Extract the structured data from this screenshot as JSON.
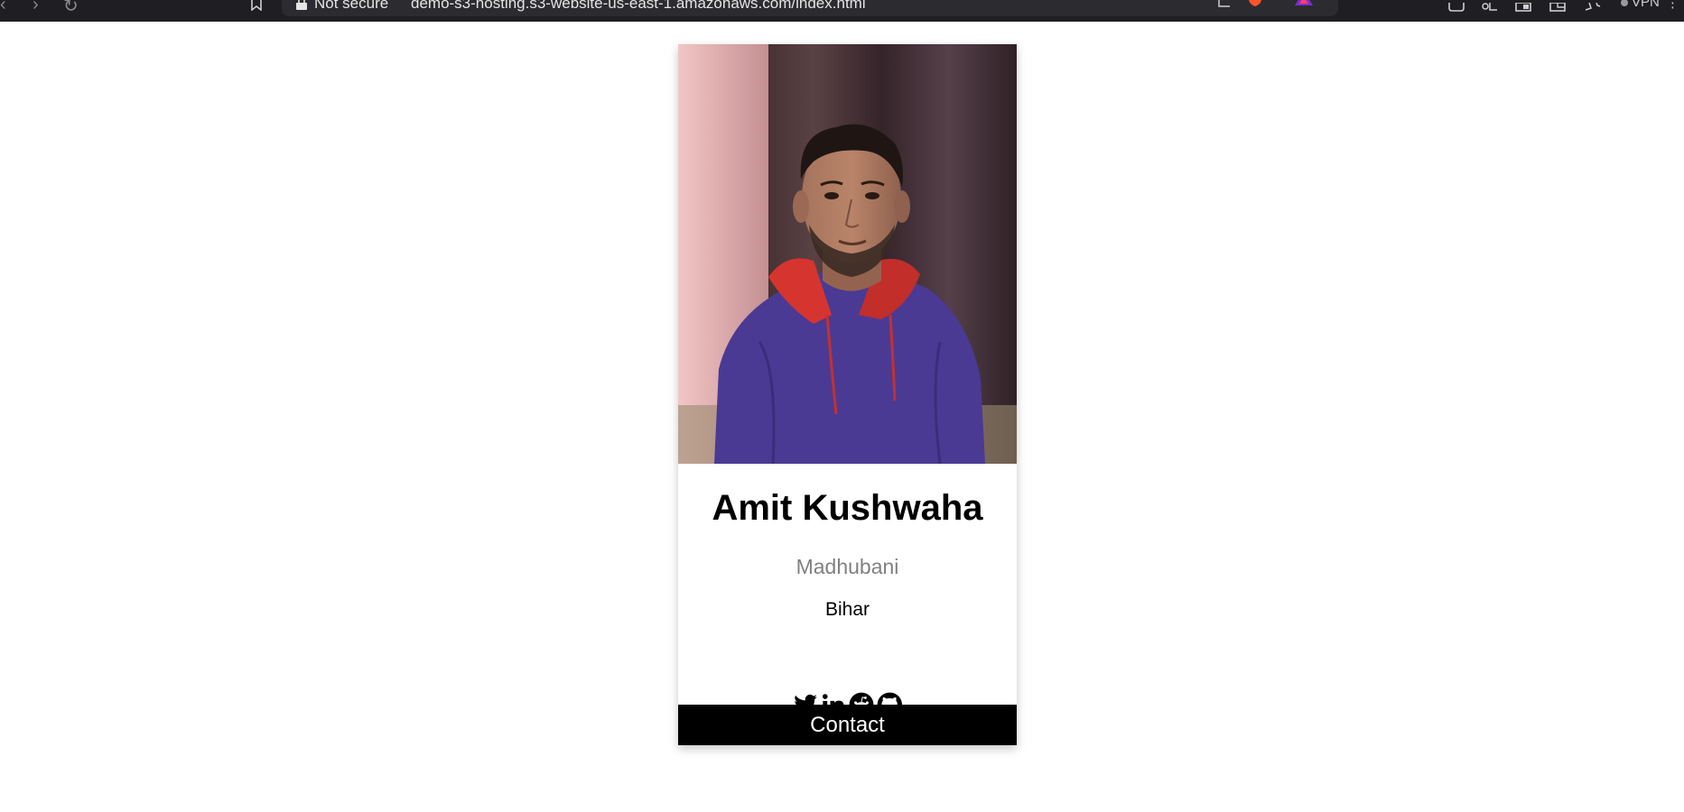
{
  "browser": {
    "security_label": "Not secure",
    "url": "demo-s3-hosting.s3-website-us-east-1.amazonaws.com/index.html",
    "vpn_label": "VPN"
  },
  "profile": {
    "name": "Amit Kushwaha",
    "city": "Madhubani",
    "state": "Bihar",
    "contact_label": "Contact",
    "photo_alt": "Amit Kushwaha"
  },
  "socials": [
    "twitter-icon",
    "linkedin-icon",
    "reddit-icon",
    "github-icon"
  ],
  "colors": {
    "button_bg": "#000000",
    "subtitle": "#808080",
    "hoodie": "#4a3a94",
    "hood_lining": "#d6352f",
    "curtain": "#4a3434"
  }
}
